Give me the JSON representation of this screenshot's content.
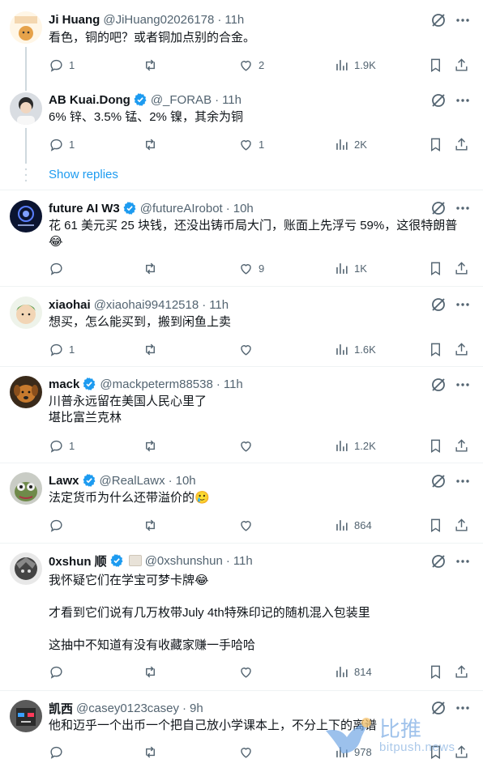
{
  "tweets": [
    {
      "name": "Ji Huang",
      "handle": "@JiHuang02026178",
      "time": "11h",
      "verified": false,
      "text": "看色，铜的吧？或者铜加点别的合金。",
      "replies": "1",
      "retweets": "",
      "likes": "2",
      "views": "1.9K"
    },
    {
      "name": "AB Kuai.Dong",
      "handle": "@_FORAB",
      "time": "11h",
      "verified": true,
      "text": "6% 锌、3.5% 锰、2% 镍，其余为铜",
      "replies": "1",
      "retweets": "",
      "likes": "1",
      "views": "2K"
    },
    {
      "name": "future AI W3",
      "handle": "@futureAIrobot",
      "time": "10h",
      "verified": true,
      "text": "花 61 美元买 25 块钱，还没出铸币局大门，账面上先浮亏 59%，这很特朗普\n😂",
      "replies": "",
      "retweets": "",
      "likes": "9",
      "views": "1K"
    },
    {
      "name": "xiaohai",
      "handle": "@xiaohai99412518",
      "time": "11h",
      "verified": false,
      "text": "想买，怎么能买到，搬到闲鱼上卖",
      "replies": "1",
      "retweets": "",
      "likes": "",
      "views": "1.6K"
    },
    {
      "name": "mack",
      "handle": "@mackpeterm88538",
      "time": "11h",
      "verified": true,
      "text": "川普永远留在美国人民心里了\n堪比富兰克林",
      "replies": "1",
      "retweets": "",
      "likes": "",
      "views": "1.2K"
    },
    {
      "name": "Lawx",
      "handle": "@RealLawx",
      "time": "10h",
      "verified": true,
      "text": "法定货币为什么还带溢价的🥲",
      "replies": "",
      "retweets": "",
      "likes": "",
      "views": "864"
    },
    {
      "name": "0xshun 顺",
      "handle": "@0xshunshun",
      "time": "11h",
      "verified": true,
      "text": "我怀疑它们在学宝可梦卡牌😂\n\n才看到它们说有几万枚带July 4th特殊印记的随机混入包装里\n\n这抽中不知道有没有收藏家赚一手哈哈",
      "replies": "",
      "retweets": "",
      "likes": "",
      "views": "814"
    },
    {
      "name": "凯西",
      "handle": "@casey0123casey",
      "time": "9h",
      "verified": false,
      "text": "他和迈乎一个出币一个把自己放小学课本上，不分上下的离谱",
      "replies": "",
      "retweets": "",
      "likes": "",
      "views": "978"
    }
  ],
  "thread": {
    "show_replies": "Show replies"
  },
  "watermark": {
    "title": "比推",
    "subtitle": "bitpush.news"
  },
  "colors": {
    "accent": "#1d9bf0",
    "muted": "#536471",
    "text": "#0f1419"
  }
}
